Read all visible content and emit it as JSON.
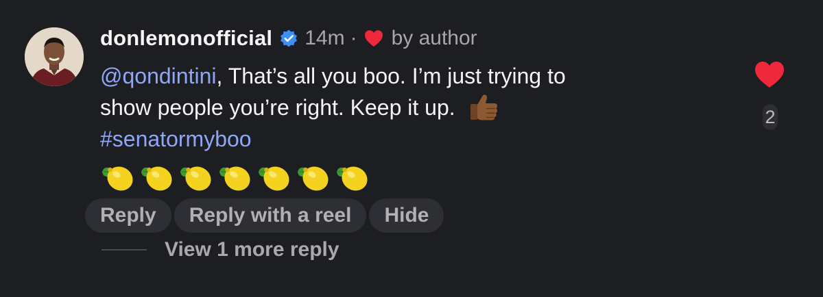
{
  "comment": {
    "username": "donlemonofficial",
    "timestamp": "14m",
    "separator": "·",
    "by_author": "by author",
    "mention": "@qondintini",
    "line1_rest": ", That’s all you boo. I’m just trying to",
    "line2": "show people you’re right. Keep it up.",
    "hashtag": "#senatormyboo",
    "emoji": {
      "thumb": "thumbs-up-icon",
      "lemon": "lemon-icon",
      "lemon_count": 7
    }
  },
  "actions": {
    "reply": "Reply",
    "reply_reel": "Reply with a reel",
    "hide": "Hide"
  },
  "replies": {
    "view_more": "View 1 more reply"
  },
  "likes": {
    "count": "2"
  },
  "colors": {
    "background": "#1d1e22",
    "link": "#8fa7f7",
    "heart": "#f0283c",
    "verified": "#3b8ff5"
  }
}
